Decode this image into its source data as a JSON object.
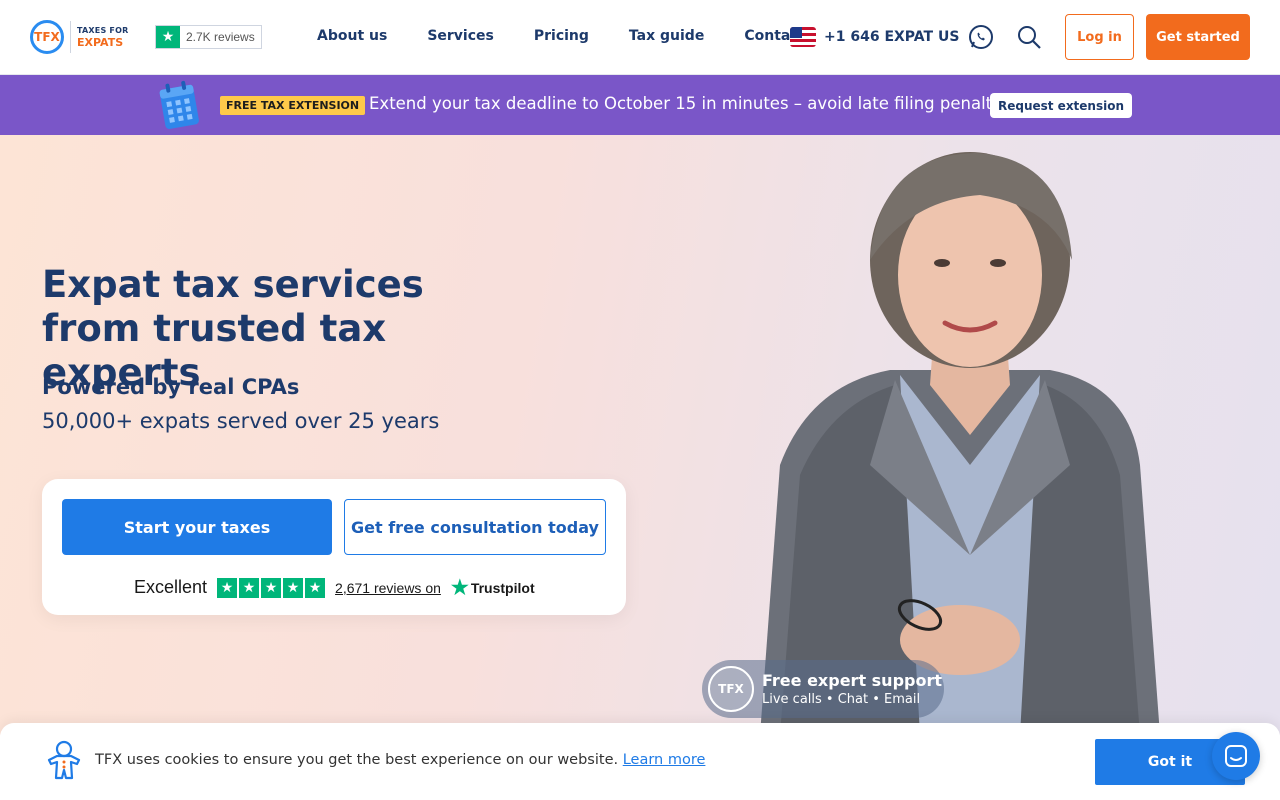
{
  "header": {
    "logo_mark": "TFX",
    "logo_line1": "TAXES FOR",
    "logo_line2": "EXPATS",
    "reviews_badge": "2.7K reviews",
    "nav": [
      "About us",
      "Services",
      "Pricing",
      "Tax guide",
      "Contact"
    ],
    "phone": "+1 646 EXPAT US",
    "login_label": "Log in",
    "get_started_label": "Get started",
    "icons": [
      "whatsapp-icon",
      "search-icon"
    ]
  },
  "promo": {
    "tag": "FREE TAX EXTENSION",
    "text": "Extend your tax deadline to October 15 in minutes – avoid late filing penalties.",
    "button": "Request extension"
  },
  "hero": {
    "title": "Expat tax services from trusted tax experts",
    "subtitle_bold": "Powered by real CPAs",
    "subtitle": "50,000+ expats served over 25 years",
    "start_button": "Start your taxes",
    "consult_button": "Get free consultation today",
    "trust_rating": "Excellent",
    "trust_reviews": "2,671 reviews on",
    "trust_brand": "Trustpilot",
    "support_title": "Free expert support",
    "support_sub": "Live calls • Chat • Email",
    "support_logo": "TFX"
  },
  "cookie": {
    "text": "TFX uses cookies to ensure you get the best experience on our website.",
    "link": "Learn more",
    "button": "Got it"
  },
  "colors": {
    "accent_orange": "#f26b1d",
    "primary_blue": "#1f7be6",
    "navy": "#1d3a6b",
    "promo_purple": "#7a56c8",
    "trustpilot_green": "#00b67a",
    "tag_yellow": "#ffc94a"
  }
}
